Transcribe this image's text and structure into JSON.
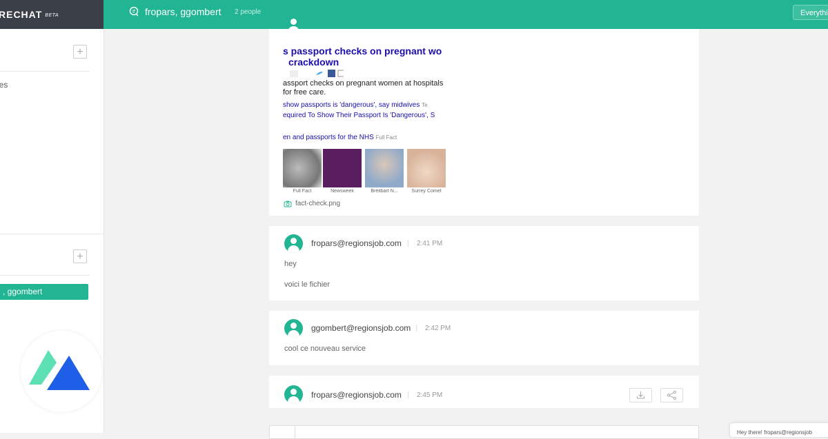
{
  "app": {
    "brand": "RECHAT",
    "badge": "BETA"
  },
  "sidebar": {
    "item_1": "les",
    "active_conversation": ", ggombert"
  },
  "header": {
    "title": "fropars, ggombert",
    "people": "2 people",
    "filter_label": "Everything"
  },
  "attachment": {
    "title_line_1": "s passport checks on pregnant wo",
    "title_line_2": "crackdown",
    "line_1": "assport checks on pregnant women at hospitals",
    "line_2": "for free care.",
    "link_1": "show passports is 'dangerous', say midwives",
    "link_1_src": "Te",
    "link_2": "equired To Show Their Passport Is 'Dangerous', S",
    "link_3": "en and passports for the NHS",
    "link_3_src": "Full Fact",
    "thumbs": [
      "Full Fact",
      "Newsweek",
      "Breitbart N...",
      "Surrey Comet"
    ],
    "filename": "fact-check.png"
  },
  "messages": [
    {
      "author": "fropars@regionsjob.com",
      "time": "2:41 PM",
      "lines": [
        "hey",
        "voici le fichier"
      ]
    },
    {
      "author": "ggombert@regionsjob.com",
      "time": "2:42 PM",
      "lines": [
        "cool ce nouveau service"
      ]
    },
    {
      "author": "fropars@regionsjob.com",
      "time": "2:45 PM",
      "lines": []
    }
  ],
  "toast": {
    "text": "Hey there! fropars@regionsjob"
  },
  "colors": {
    "accent": "#22b593",
    "sidebar_header": "#3a3f48",
    "link": "#1a0dab"
  }
}
